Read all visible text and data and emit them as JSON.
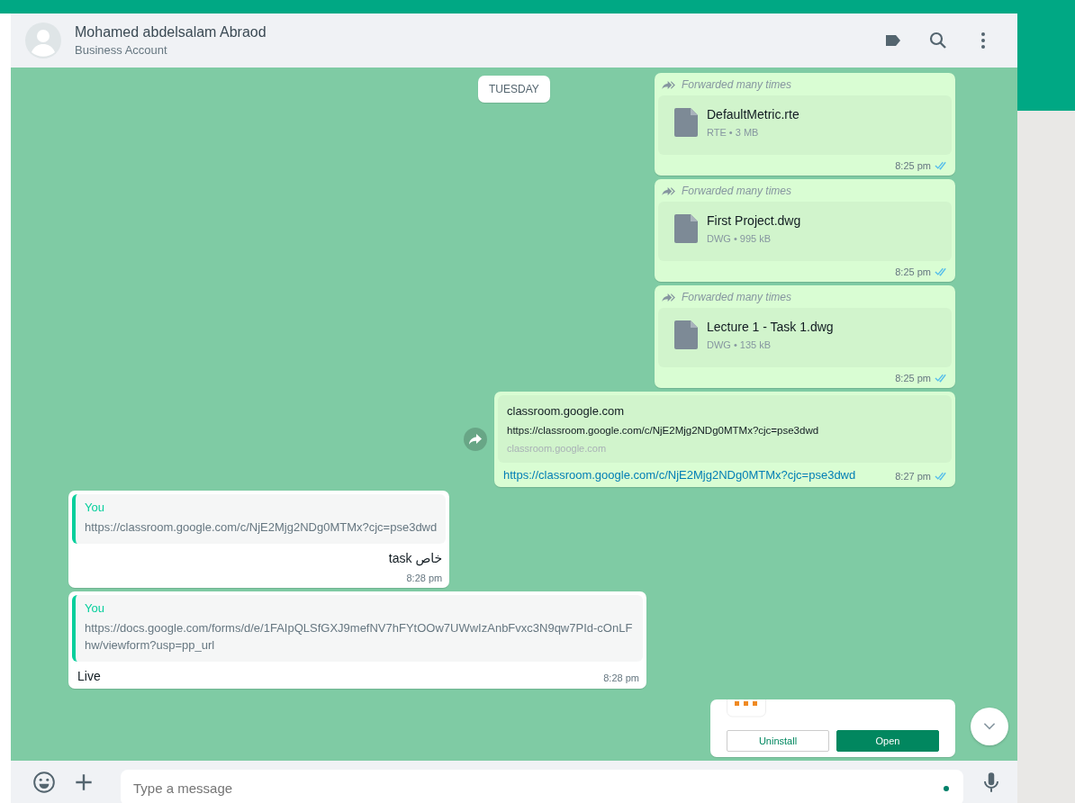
{
  "header": {
    "name": "Mohamed abdelsalam Abraod",
    "subtitle": "Business Account"
  },
  "date_chip": "TUESDAY",
  "messages": [
    {
      "kind": "file",
      "outgoing": true,
      "forwarded": "Forwarded many times",
      "file_name": "DefaultMetric.rte",
      "file_meta": "RTE • 3 MB",
      "time": "8:25 pm",
      "read": true
    },
    {
      "kind": "file",
      "outgoing": true,
      "forwarded": "Forwarded many times",
      "file_name": "First Project.dwg",
      "file_meta": "DWG • 995 kB",
      "time": "8:25 pm",
      "read": true
    },
    {
      "kind": "file",
      "outgoing": true,
      "forwarded": "Forwarded many times",
      "file_name": "Lecture 1 - Task 1.dwg",
      "file_meta": "DWG • 135 kB",
      "time": "8:25 pm",
      "read": true
    },
    {
      "kind": "link",
      "outgoing": true,
      "preview_title": "classroom.google.com",
      "preview_text": "https://classroom.google.com/c/NjE2Mjg2NDg0MTMx?cjc=pse3dwd",
      "preview_domain": "classroom.google.com",
      "link": "https://classroom.google.com/c/NjE2Mjg2NDg0MTMx?cjc=pse3dwd",
      "time": "8:27 pm",
      "read": true
    },
    {
      "kind": "quote",
      "outgoing": false,
      "quote_author": "You",
      "quote_text": "https://classroom.google.com/c/NjE2Mjg2NDg0MTMx?cjc=pse3dwd",
      "text": "خاص task",
      "rtl": true,
      "time": "8:28 pm"
    },
    {
      "kind": "quote",
      "outgoing": false,
      "quote_author": "You",
      "quote_text": "https://docs.google.com/forms/d/e/1FAIpQLSfGXJ9mefNV7hFYtOOw7UWwIzAnbFvxc3N9qw7PId-cOnLFhw/viewform?usp=pp_url",
      "text": "Live",
      "rtl": false,
      "time": "8:28 pm"
    },
    {
      "kind": "app",
      "outgoing": true,
      "buttons": [
        "Uninstall",
        "Open"
      ]
    }
  ],
  "composer": {
    "placeholder": "Type a message"
  }
}
